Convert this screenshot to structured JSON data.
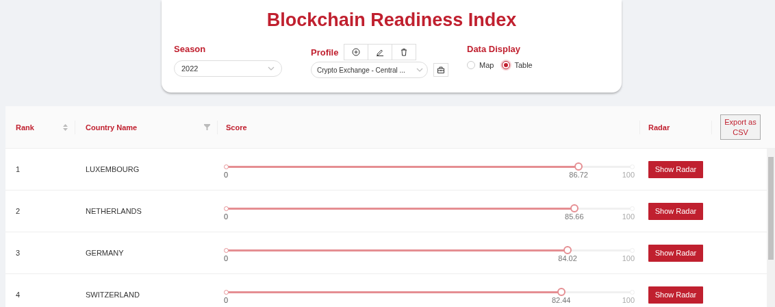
{
  "title": "Blockchain Readiness Index",
  "season": {
    "label": "Season",
    "value": "2022"
  },
  "profile": {
    "label": "Profile",
    "value": "Crypto Exchange - Central ..."
  },
  "data_display": {
    "label": "Data Display",
    "options": [
      {
        "label": "Map",
        "selected": false
      },
      {
        "label": "Table",
        "selected": true
      }
    ]
  },
  "table": {
    "columns": [
      "Rank",
      "Country Name",
      "Score",
      "Radar"
    ],
    "export_button": "Export as CSV",
    "rows": [
      {
        "rank": "1",
        "country": "LUXEMBOURG",
        "min": "0",
        "score": "86.72",
        "max": "100",
        "level": 0.8672,
        "button": "Show Radar"
      },
      {
        "rank": "2",
        "country": "NETHERLANDS",
        "min": "0",
        "score": "85.66",
        "max": "100",
        "level": 0.8566,
        "button": "Show Radar"
      },
      {
        "rank": "3",
        "country": "GERMANY",
        "min": "0",
        "score": "84.02",
        "max": "100",
        "level": 0.8402,
        "button": "Show Radar"
      },
      {
        "rank": "4",
        "country": "SWITZERLAND",
        "min": "0",
        "score": "82.44",
        "max": "100",
        "level": 0.8244,
        "button": "Show Radar"
      }
    ]
  }
}
